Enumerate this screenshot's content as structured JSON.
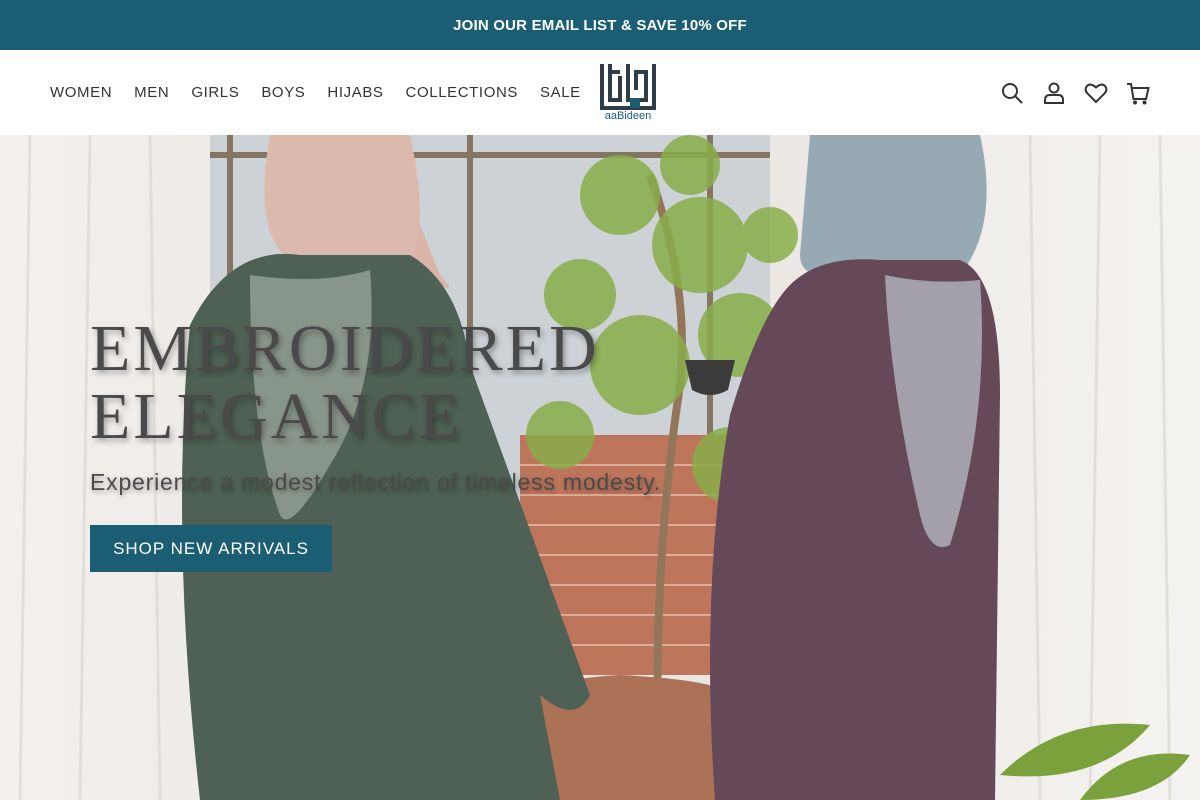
{
  "announcement": {
    "text": "JOIN OUR EMAIL LIST & SAVE 10% OFF"
  },
  "nav": {
    "items": [
      "WOMEN",
      "MEN",
      "GIRLS",
      "BOYS",
      "HIJABS",
      "COLLECTIONS",
      "SALE"
    ]
  },
  "logo": {
    "text": "aaBideen"
  },
  "header_icons": [
    "search-icon",
    "account-icon",
    "wishlist-heart-icon",
    "cart-icon"
  ],
  "hero": {
    "title_line1": "EMBROIDERED",
    "title_line2": "ELEGANCE",
    "subtitle": "Experience a modest reflection of timeless modesty.",
    "cta_label": "SHOP NEW ARRIVALS"
  },
  "colors": {
    "brand": "#1b5e74",
    "nav_text": "#333333",
    "hero_text": "#4a4a4a"
  }
}
